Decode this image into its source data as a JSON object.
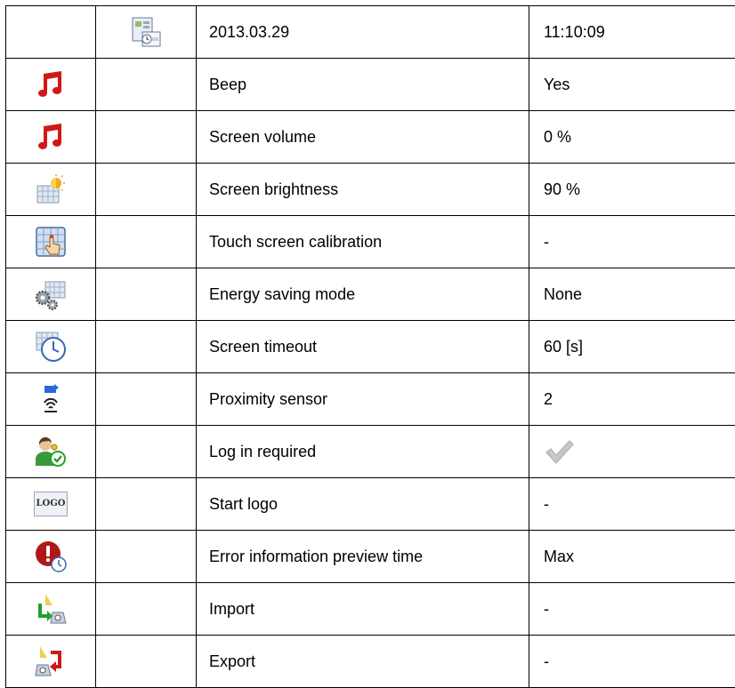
{
  "header": {
    "date": "2013.03.29",
    "time": "11:10:09"
  },
  "rows": [
    {
      "icon": "music-note-icon",
      "label": "Beep",
      "value": "Yes"
    },
    {
      "icon": "music-note-icon",
      "label": "Screen volume",
      "value": "0 %"
    },
    {
      "icon": "brightness-sun-icon",
      "label": "Screen brightness",
      "value": "90 %"
    },
    {
      "icon": "touch-calibration-icon",
      "label": "Touch screen calibration",
      "value": "-"
    },
    {
      "icon": "energy-gears-icon",
      "label": "Energy saving mode",
      "value": "None"
    },
    {
      "icon": "screen-clock-icon",
      "label": "Screen timeout",
      "value": "60 [s]"
    },
    {
      "icon": "proximity-sensor-icon",
      "label": "Proximity sensor",
      "value": "2"
    },
    {
      "icon": "user-login-icon",
      "label": "Log in required",
      "value": "",
      "value_icon": "checkmark-icon"
    },
    {
      "icon": "logo-icon",
      "label": "Start logo",
      "value": "-",
      "icon_text": "LOGO"
    },
    {
      "icon": "error-clock-icon",
      "label": "Error information preview time",
      "value": "Max"
    },
    {
      "icon": "import-icon",
      "label": "Import",
      "value": "-"
    },
    {
      "icon": "export-icon",
      "label": "Export",
      "value": "-"
    }
  ],
  "colors": {
    "note_red": "#d01818",
    "border": "#000000",
    "check_gray": "#c8c8c8",
    "sensor_blue": "#2a6ad8"
  }
}
